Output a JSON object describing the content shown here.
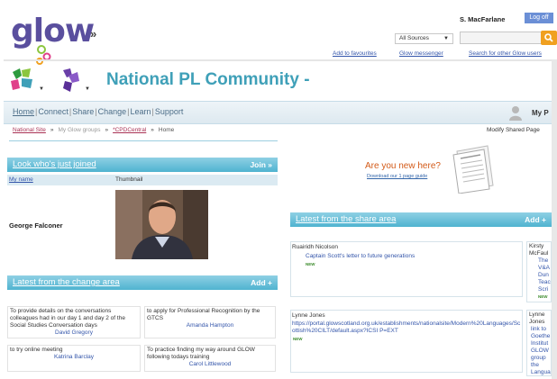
{
  "header": {
    "logo_text": "glow",
    "expand_glyph": "»",
    "username": "S. MacFarlane",
    "logoff_label": "Log off",
    "sources_value": "All Sources",
    "search_value": "",
    "links": {
      "favourites": "Add to favourites",
      "messenger": "Glow messenger",
      "search_users": "Search for other Glow users"
    }
  },
  "community": {
    "title": "National PL Community -"
  },
  "nav": {
    "items": [
      "Home",
      "Connect",
      "Share",
      "Change",
      "Learn",
      "Support"
    ],
    "my_label": "My P"
  },
  "breadcrumb": {
    "items": [
      "National Site",
      "My Glow groups",
      "*CPDCentral",
      "Home"
    ],
    "separator": "»",
    "modify_label": "Modify Shared Page"
  },
  "joined": {
    "title": "Look who's just joined",
    "action": "Join »",
    "col_name": "My name",
    "col_thumb": "Thumbnail",
    "member_name": "George Falconer"
  },
  "change": {
    "title": "Latest from the change area",
    "action": "Add +",
    "items": [
      {
        "text": "To provide details on the conversations colleagues had in our day 1 and day 2 of the Social Studies Conversation days",
        "who": "David Gregory"
      },
      {
        "text": "to apply for Professional Recognition by the GTCS",
        "who": "Amanda Hampton"
      },
      {
        "text": "to try online meeting",
        "who": "Katrina Barclay"
      },
      {
        "text": "To practice finding my way around GLOW following todays training",
        "who": "Carol Littlewood"
      }
    ]
  },
  "promo": {
    "title": "Are you new here?",
    "link": "Download our 1 page guide"
  },
  "share": {
    "title": "Latest from the share area",
    "action": "Add +",
    "items": [
      {
        "author": "Ruairidh Nicolson",
        "link": "Captain Scott's letter to future generations",
        "badge": "NEW"
      },
      {
        "author": "Lynne Jones",
        "link": "https://portal.glowscotland.org.uk/establishments/nationalsite/Modern%20Languages/Scottish%20CILT/default.aspx?ICSI P=EXT",
        "badge": "NEW"
      }
    ],
    "side1": {
      "name": "Kirsty McFaul",
      "lines": [
        "The",
        "V&A",
        "Dun",
        "Teac",
        "Scri"
      ],
      "badge": "NEW"
    },
    "side2": {
      "name": "Lynne Jones",
      "lines": [
        "link to",
        "Goethe",
        "Institut",
        "GLOW",
        "group",
        "the",
        "Langua"
      ]
    }
  },
  "colors": {
    "accent": "#4fb3d0",
    "title": "#3fa0b8",
    "logo": "#5a4f9e",
    "promo": "#d35a18",
    "search": "#f0a020"
  }
}
